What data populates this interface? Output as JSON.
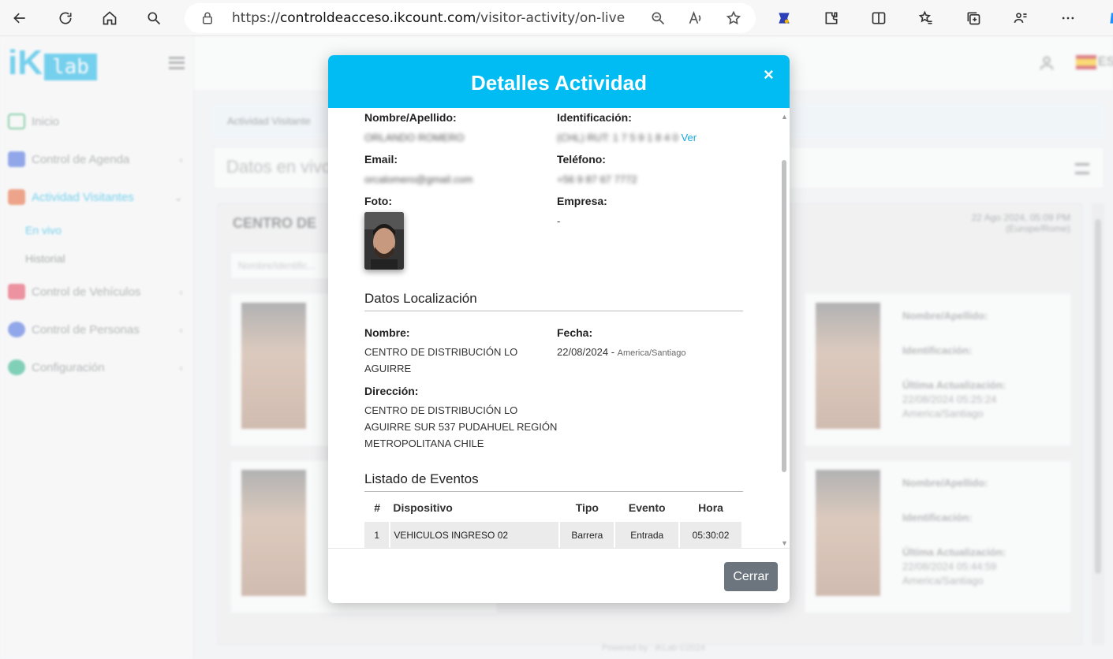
{
  "browser": {
    "url_prefix": "https://",
    "url_domain": "controldeacceso.ikcount.com",
    "url_path": "/visitor-activity/on-live"
  },
  "sidebar": {
    "logo_ik": "iK",
    "logo_lab": "lab",
    "items": [
      {
        "label": "Inicio"
      },
      {
        "label": "Control de Agenda"
      },
      {
        "label": "Actividad Visitantes"
      },
      {
        "label": "Control de Vehículos"
      },
      {
        "label": "Control de Personas"
      },
      {
        "label": "Configuración"
      }
    ],
    "submenu": [
      "En vivo",
      "Historial"
    ]
  },
  "topbar": {
    "lang": "ES"
  },
  "breadcrumb": "Actividad Visitante",
  "live_title": "Datos en vivo",
  "center": {
    "title": "CENTRO DE",
    "date": "22 Ago 2024, 05:09 PM",
    "tz": "(Europe/Rome)",
    "search_placeholder": "Nombre/Identific..."
  },
  "cards": [
    {
      "name_label": "Nombre/Apellido:",
      "id_label": "Identificación:",
      "upd_label": "Última Actualización:",
      "upd": "22/08/2024 05:25:24",
      "tz": "America/Santiago"
    },
    {
      "name_label": "Nombre/Apellido:",
      "id_label": "Identificación:",
      "upd_label": "Última Actualización:",
      "upd": "22/08/2024 05:44:59",
      "tz": "America/Santiago"
    }
  ],
  "footer": "Powered by : iKLab ©2024",
  "modal": {
    "title": "Detalles Actividad",
    "close_symbol": "×",
    "labels": {
      "name": "Nombre/Apellido:",
      "identification": "Identificación:",
      "email": "Email:",
      "phone": "Teléfono:",
      "photo": "Foto:",
      "company": "Empresa:"
    },
    "values": {
      "name": "ORLANDO ROMERO",
      "identification": "(CHL) RUT: 1 7 5 9 1 8 4 0",
      "see_link": "Ver",
      "email": "orcalomero@gmail.com",
      "phone": "+56 9 87 67 7772",
      "company": "-"
    },
    "location": {
      "title": "Datos Localización",
      "name_label": "Nombre:",
      "name_value_1": "CENTRO DE DISTRIBUCIÓN LO",
      "name_value_2": "AGUIRRE",
      "date_label": "Fecha:",
      "date_value": "22/08/2024",
      "date_sep": " - ",
      "date_tz": "America/Santiago",
      "address_label": "Dirección:",
      "address_1": "CENTRO DE DISTRIBUCIÓN LO",
      "address_2": "AGUIRRE SUR 537 PUDAHUEL REGIÓN",
      "address_3": "METROPOLITANA CHILE"
    },
    "events": {
      "title": "Listado de Eventos",
      "headers": {
        "num": "#",
        "device": "Dispositivo",
        "type": "Tipo",
        "event": "Evento",
        "time": "Hora"
      },
      "rows": [
        {
          "num": "1",
          "device": "VEHICULOS INGRESO 02",
          "type": "Barrera",
          "event": "Entrada",
          "time": "05:30:02"
        }
      ]
    },
    "close_button": "Cerrar"
  }
}
